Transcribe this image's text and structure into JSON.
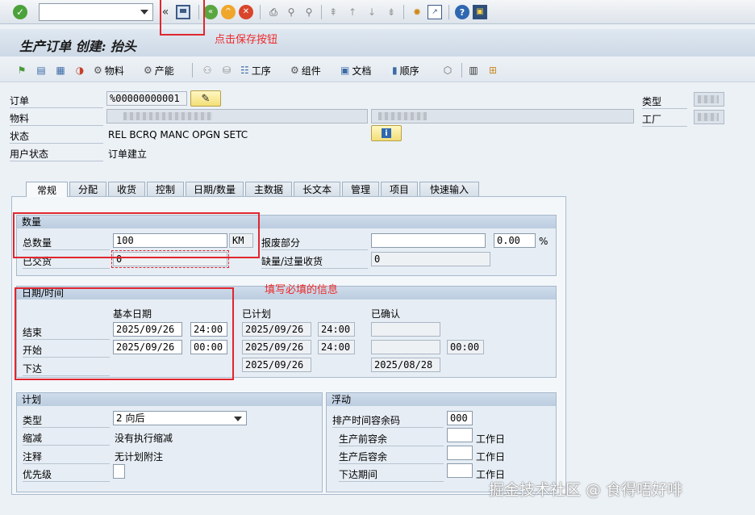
{
  "toolbar": {
    "command_field_value": "",
    "collapse_symbol": "«"
  },
  "window": {
    "title": "生产订单 创建: 抬头"
  },
  "app_toolbar": {
    "material_label": "物料",
    "capacity_label": "产能",
    "operations_label": "工序",
    "components_label": "组件",
    "documents_label": "文档",
    "sequence_label": "顺序"
  },
  "header": {
    "order_label": "订单",
    "order_value": "%00000000001",
    "material_label": "物料",
    "status_label": "状态",
    "status_value": "REL  BCRQ MANC OPGN SETC",
    "user_status_label": "用户状态",
    "user_status_value": "订单建立",
    "type_label": "类型",
    "plant_label": "工厂"
  },
  "tabs": [
    "常规",
    "分配",
    "收货",
    "控制",
    "日期/数量",
    "主数据",
    "长文本",
    "管理",
    "项目",
    "快速输入"
  ],
  "quantity": {
    "group_title": "数量",
    "total_label": "总数量",
    "total_value": "100",
    "unit": "KM",
    "scrap_label": "报废部分",
    "scrap_value": "",
    "scrap_pct": "0.00",
    "pct_sign": "%",
    "delivered_label": "已交货",
    "delivered_value": "0",
    "short_label": "缺量/过量收货",
    "short_value": "0"
  },
  "dates": {
    "group_title": "日期/时间",
    "basic_header": "基本日期",
    "scheduled_header": "已计划",
    "confirmed_header": "已确认",
    "finish_label": "结束",
    "start_label": "开始",
    "release_label": "下达",
    "basic_finish_date": "2025/09/26",
    "basic_finish_time": "24:00",
    "basic_start_date": "2025/09/26",
    "basic_start_time": "00:00",
    "sched_finish_date": "2025/09/26",
    "sched_finish_time": "24:00",
    "sched_start_date": "2025/09/26",
    "sched_start_time": "24:00",
    "sched_release_date": "2025/09/26",
    "conf_start_time": "00:00",
    "conf_release_date": "2025/08/28"
  },
  "planning": {
    "group_title": "计划",
    "type_label": "类型",
    "type_value": "2 向后",
    "reduction_label": "缩减",
    "reduction_value": "没有执行缩减",
    "note_label": "注释",
    "note_value": "无计划附注",
    "priority_label": "优先级",
    "priority_value": ""
  },
  "float": {
    "group_title": "浮动",
    "sm_key_label": "排产时间容余码",
    "sm_key_value": "000",
    "before_label": "生产前容余",
    "after_label": "生产后容余",
    "release_period_label": "下达期间",
    "unit_label": "工作日"
  },
  "annotations": {
    "save_hint": "点击保存按钮",
    "fill_hint": "填写必填的信息"
  },
  "watermark": "掘金技术社区 @ 食得唔好啡",
  "colors": {
    "annotation_red": "#e0262f",
    "group_header": "#c7d6e6",
    "background": "#ecf1f6"
  }
}
